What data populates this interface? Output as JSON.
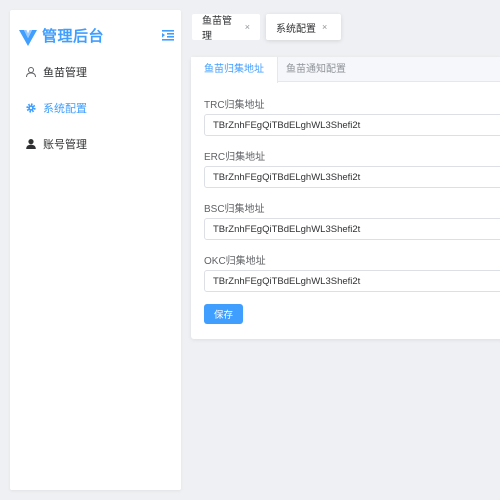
{
  "brand": {
    "title": "管理后台",
    "logo_icon": "v-logo-icon",
    "accent_color": "#409eff"
  },
  "sidebar": {
    "collapse_icon": "menu-fold-icon",
    "items": [
      {
        "label": "鱼苗管理",
        "icon": "user-outline-icon",
        "active": false
      },
      {
        "label": "系统配置",
        "icon": "gear-icon",
        "active": true
      },
      {
        "label": "账号管理",
        "icon": "user-filled-icon",
        "active": false
      }
    ]
  },
  "tabs": [
    {
      "label": "鱼苗管理",
      "close": "×",
      "active": false
    },
    {
      "label": "系统配置",
      "close": "×",
      "active": true
    }
  ],
  "card": {
    "tabs": [
      {
        "label": "鱼苗归集地址",
        "active": true
      },
      {
        "label": "鱼苗通知配置",
        "active": false
      }
    ],
    "fields": [
      {
        "label": "TRC归集地址",
        "value": "TBrZnhFEgQiTBdELghWL3Shefi2t"
      },
      {
        "label": "ERC归集地址",
        "value": "TBrZnhFEgQiTBdELghWL3Shefi2t"
      },
      {
        "label": "BSC归集地址",
        "value": "TBrZnhFEgQiTBdELghWL3Shefi2t"
      },
      {
        "label": "OKC归集地址",
        "value": "TBrZnhFEgQiTBdELghWL3Shefi2t"
      }
    ],
    "save_label": "保存"
  }
}
